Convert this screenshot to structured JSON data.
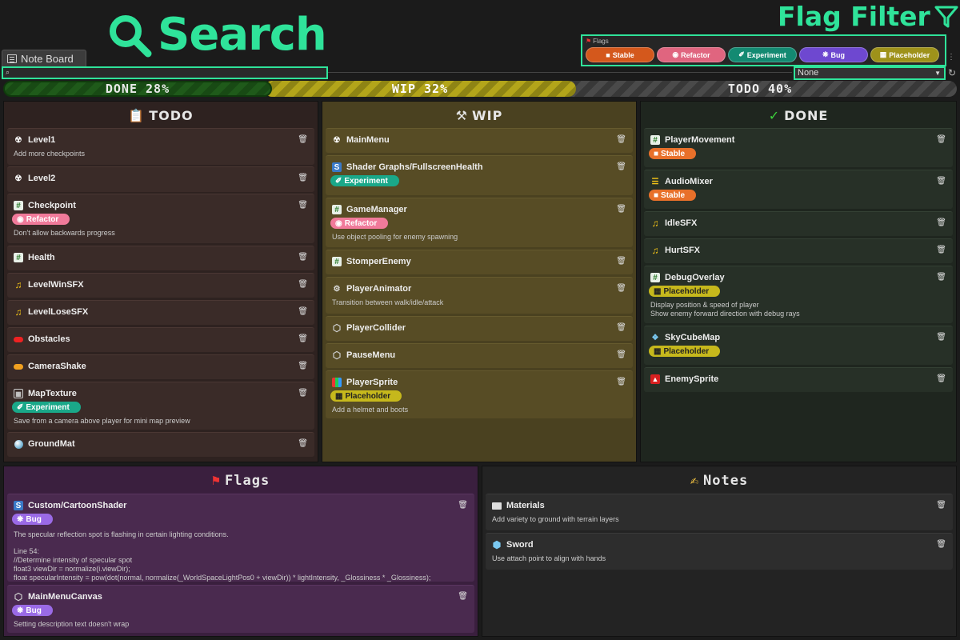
{
  "window": {
    "tab_label": "Note Board"
  },
  "callouts": {
    "search": "Search",
    "flag_filter": "Flag Filter"
  },
  "flags_filter": {
    "label": "Flags",
    "items": [
      {
        "label": "Stable",
        "color": "#d4581c"
      },
      {
        "label": "Refactor",
        "color": "#e0657f"
      },
      {
        "label": "Experiment",
        "color": "#138a72"
      },
      {
        "label": "Bug",
        "color": "#6e48d0"
      },
      {
        "label": "Placeholder",
        "color": "#9e921a"
      }
    ]
  },
  "search": {
    "value": ""
  },
  "dropdown": {
    "selected": "None"
  },
  "progress": {
    "done_label": "DONE 28%",
    "done_fraction": 0.28,
    "wip_label": "WIP 32%",
    "wip_fraction": 0.32,
    "todo_label": "TODO 40%",
    "todo_fraction": 0.4
  },
  "columns": {
    "todo": {
      "title": "TODO",
      "cards": [
        {
          "title": "Level1",
          "desc": "Add more checkpoints"
        },
        {
          "title": "Level2"
        },
        {
          "title": "Checkpoint",
          "tag": "Refactor",
          "desc": "Don't allow backwards progress"
        },
        {
          "title": "Health"
        },
        {
          "title": "LevelWinSFX"
        },
        {
          "title": "LevelLoseSFX"
        },
        {
          "title": "Obstacles"
        },
        {
          "title": "CameraShake"
        },
        {
          "title": "MapTexture",
          "tag": "Experiment",
          "desc": "Save from a camera above player for mini map preview"
        },
        {
          "title": "GroundMat"
        }
      ]
    },
    "wip": {
      "title": "WIP",
      "cards": [
        {
          "title": "MainMenu"
        },
        {
          "title": "Shader Graphs/FullscreenHealth",
          "tag": "Experiment"
        },
        {
          "title": "GameManager",
          "tag": "Refactor",
          "desc": "Use object pooling for enemy spawning"
        },
        {
          "title": "StomperEnemy"
        },
        {
          "title": "PlayerAnimator",
          "desc": "Transition between walk/idle/attack"
        },
        {
          "title": "PlayerCollider"
        },
        {
          "title": "PauseMenu"
        },
        {
          "title": "PlayerSprite",
          "tag": "Placeholder",
          "desc": "Add a helmet and boots"
        }
      ]
    },
    "done": {
      "title": "DONE",
      "cards": [
        {
          "title": "PlayerMovement",
          "tag": "Stable"
        },
        {
          "title": "AudioMixer",
          "tag": "Stable"
        },
        {
          "title": "IdleSFX"
        },
        {
          "title": "HurtSFX"
        },
        {
          "title": "DebugOverlay",
          "tag": "Placeholder",
          "desc": "Display position & speed of player",
          "desc2": "Show enemy forward direction with debug rays"
        },
        {
          "title": "SkyCubeMap",
          "tag": "Placeholder"
        },
        {
          "title": "EnemySprite"
        }
      ]
    },
    "flags": {
      "title": "Flags",
      "cards": [
        {
          "title": "Custom/CartoonShader",
          "tag": "Bug",
          "desc": "The specular reflection spot is flashing in certain lighting conditions.",
          "code": [
            "Line 54:",
            "//Determine intensity of specular spot",
            "float3 viewDir = normalize(i.viewDir);",
            "float specularIntensity = pow(dot(normal, normalize(_WorldSpaceLightPos0 + viewDir)) * lightIntensity, _Glossiness * _Glossiness);"
          ]
        },
        {
          "title": "MainMenuCanvas",
          "tag": "Bug",
          "desc": "Setting description text doesn't wrap"
        }
      ]
    },
    "notes": {
      "title": "Notes",
      "cards": [
        {
          "title": "Materials",
          "desc": "Add variety to ground with terrain layers"
        },
        {
          "title": "Sword",
          "desc": "Use attach point to align with hands"
        }
      ]
    }
  }
}
